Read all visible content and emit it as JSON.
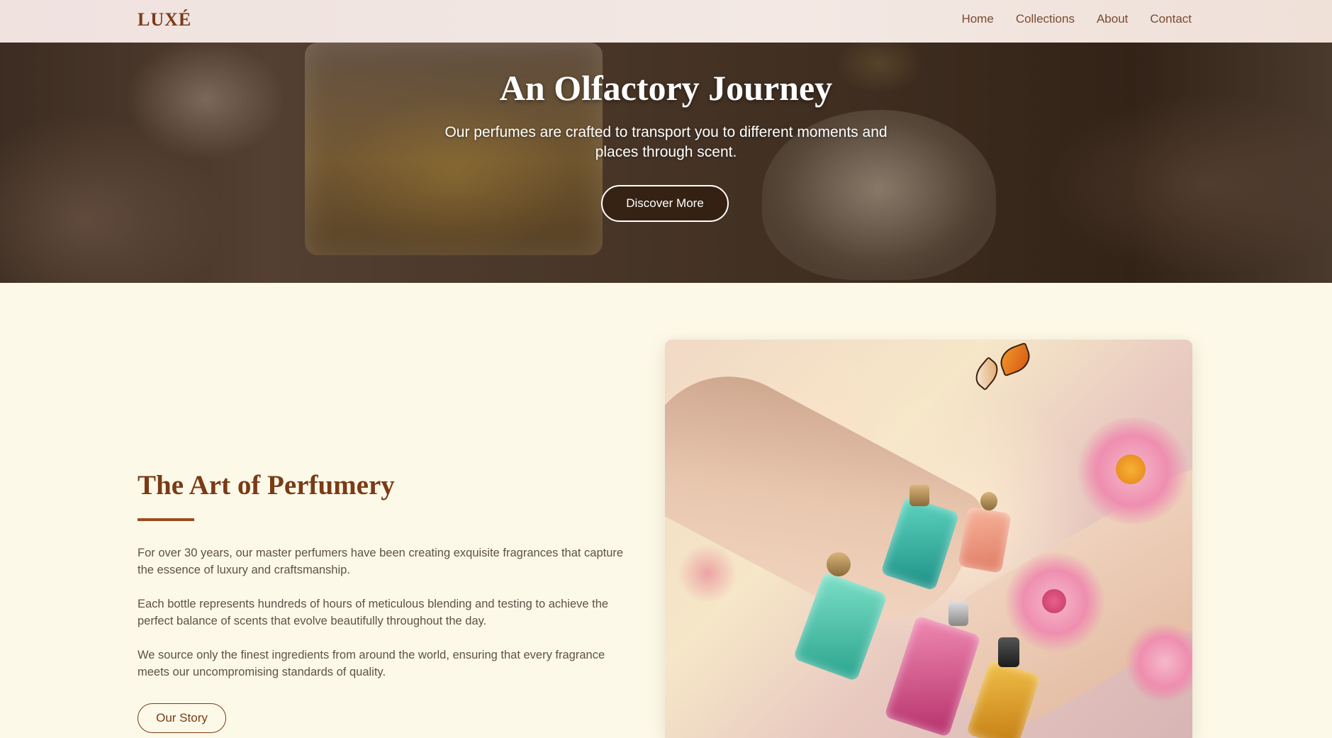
{
  "brand": {
    "logo": "LUXÉ"
  },
  "nav": {
    "links": [
      "Home",
      "Collections",
      "About",
      "Contact"
    ]
  },
  "hero": {
    "title": "An Olfactory Journey",
    "subtitle": "Our perfumes are crafted to transport you to different moments and places through scent.",
    "cta": "Discover More"
  },
  "about": {
    "title": "The Art of Perfumery",
    "paragraphs": [
      "For over 30 years, our master perfumers have been creating exquisite fragrances that capture the essence of luxury and craftsmanship.",
      "Each bottle represents hundreds of hours of meticulous blending and testing to achieve the perfect balance of scents that evolve beautifully throughout the day.",
      "We source only the finest ingredients from around the world, ensuring that every fragrance meets our uncompromising standards of quality."
    ],
    "cta": "Our Story"
  },
  "colors": {
    "brand": "#7a3b16",
    "background": "#fdf9e8",
    "nav_background": "#f1e5e0",
    "body_text": "#5f5048"
  }
}
